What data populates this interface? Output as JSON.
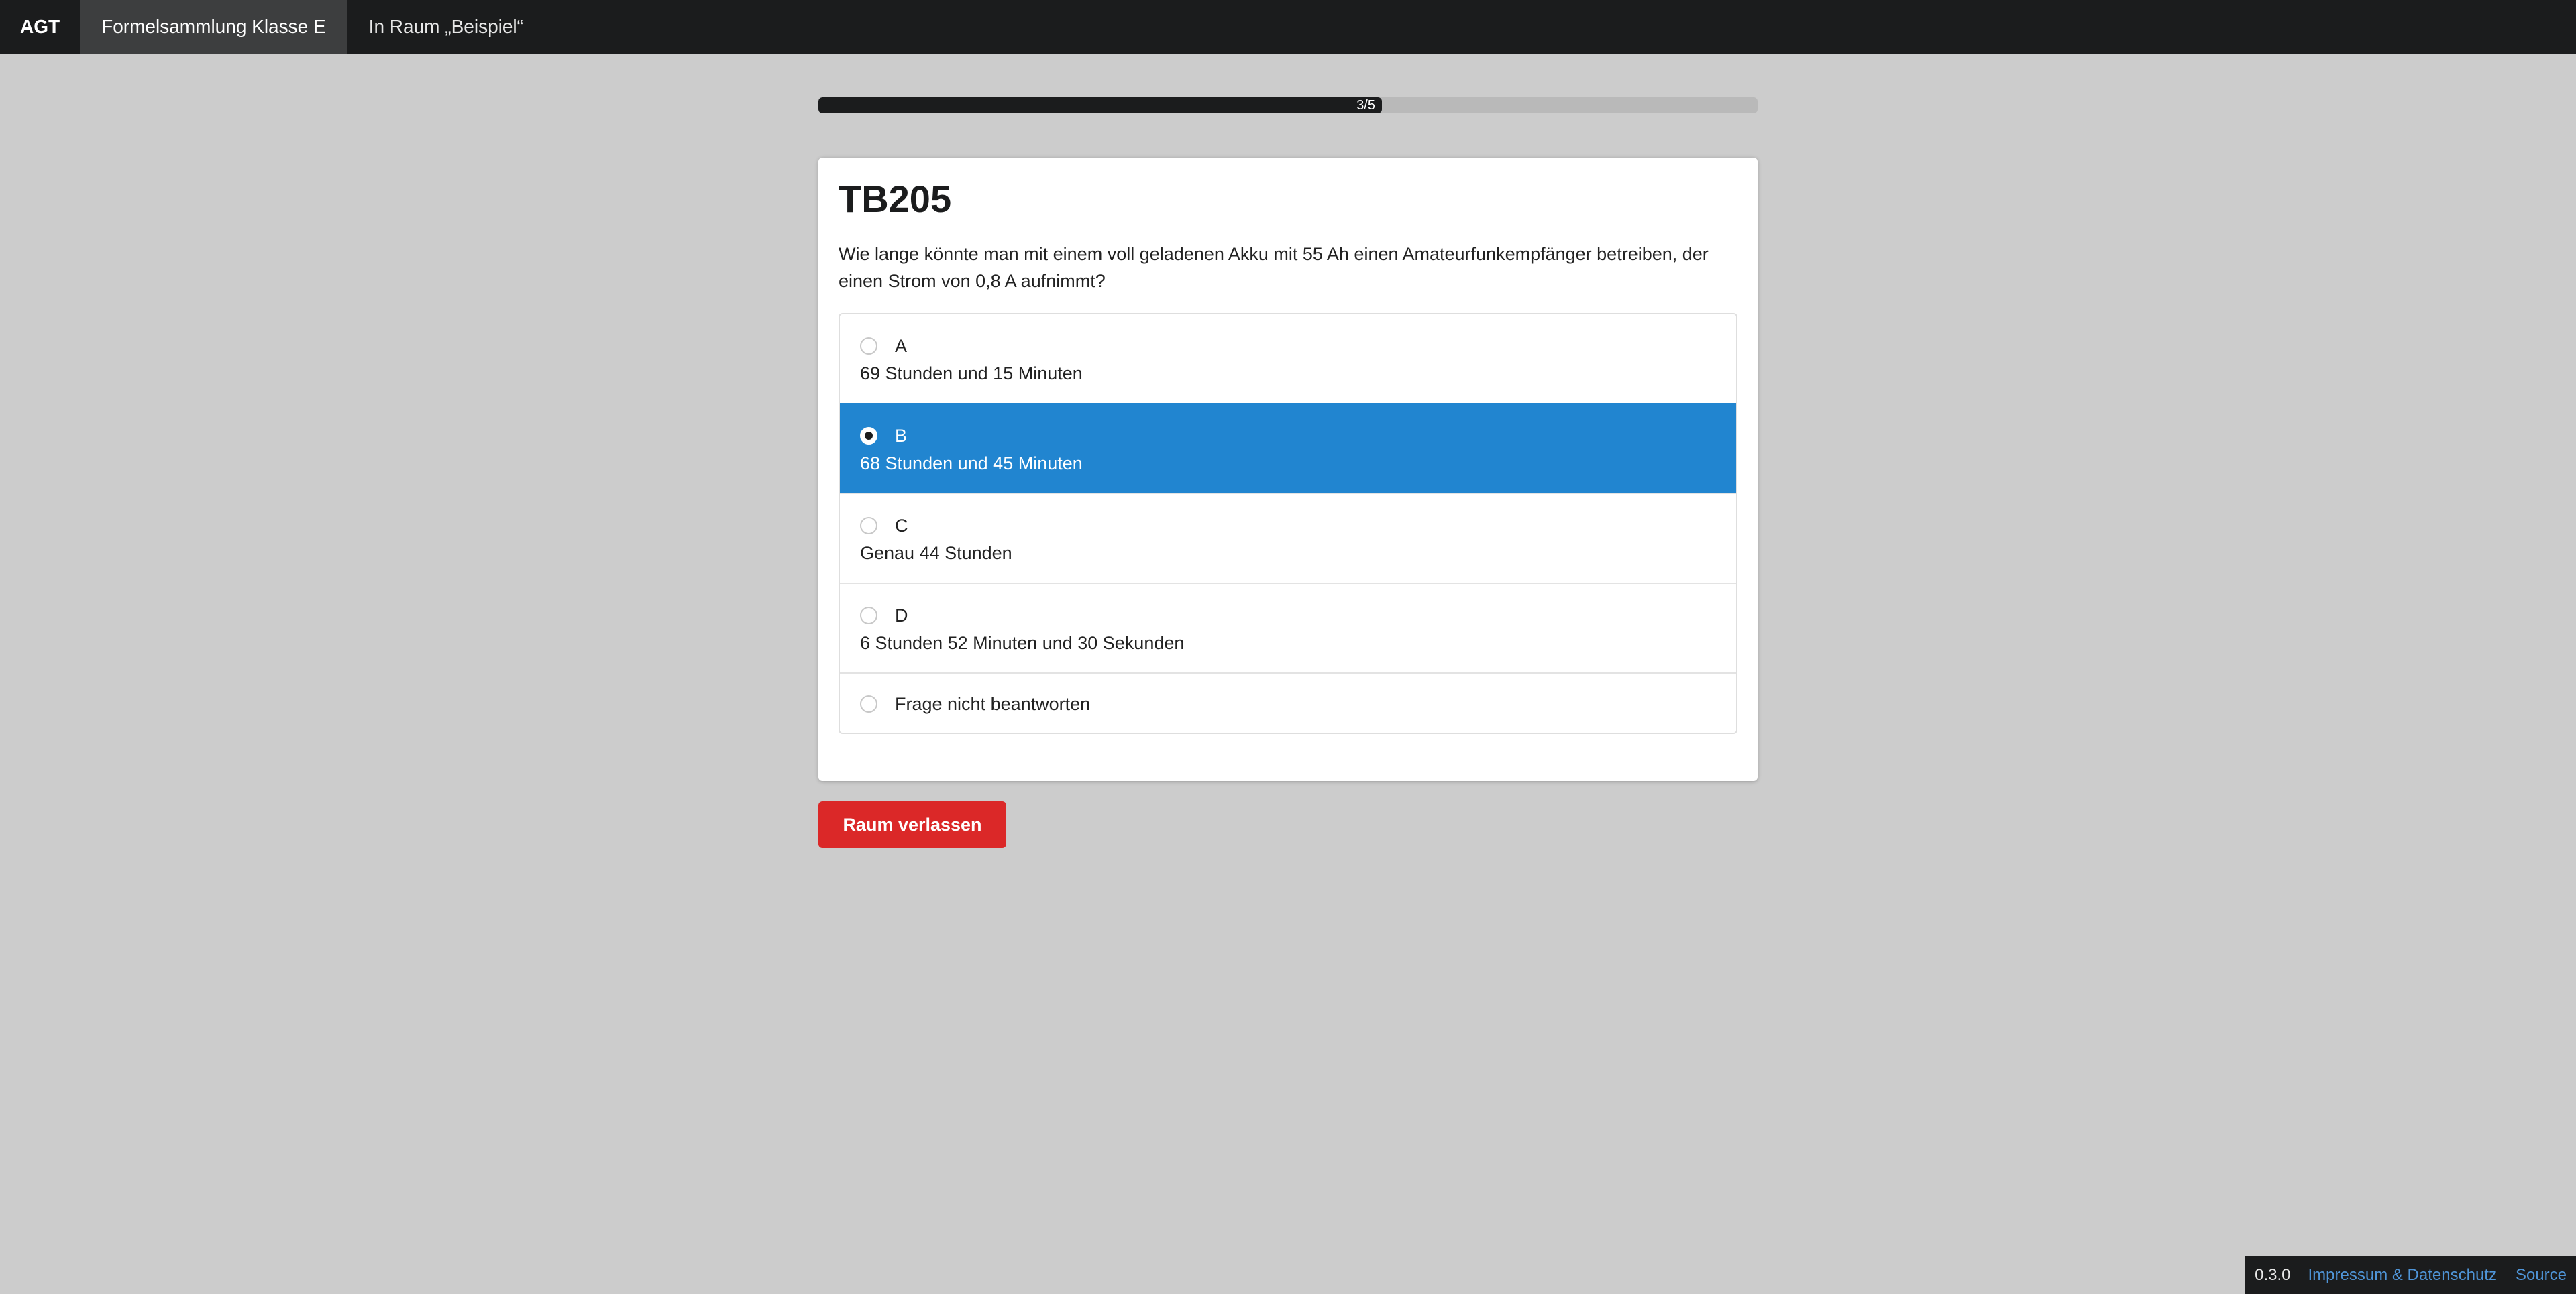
{
  "nav": {
    "brand": "AGT",
    "items": [
      {
        "label": "Formelsammlung Klasse E",
        "active": true
      },
      {
        "label": "In Raum „Beispiel“",
        "active": false
      }
    ]
  },
  "progress": {
    "label": "3/5",
    "current": 3,
    "total": 5,
    "fraction": 0.6
  },
  "question": {
    "id": "TB205",
    "text": "Wie lange könnte man mit einem voll geladenen Akku mit 55 Ah einen Amateurfunkempfänger betreiben, der einen Strom von 0,8 A aufnimmt?"
  },
  "answers": [
    {
      "letter": "A",
      "text": "69 Stunden und 15 Minuten",
      "selected": false
    },
    {
      "letter": "B",
      "text": "68 Stunden und 45 Minuten",
      "selected": true
    },
    {
      "letter": "C",
      "text": "Genau 44 Stunden",
      "selected": false
    },
    {
      "letter": "D",
      "text": "6 Stunden 52 Minuten und 30 Sekunden",
      "selected": false
    }
  ],
  "skip_label": "Frage nicht beantworten",
  "leave_button": "Raum verlassen",
  "footer": {
    "version": "0.3.0",
    "links": [
      "Impressum & Datenschutz",
      "Source"
    ]
  },
  "colors": {
    "selected": "#2185d0",
    "danger": "#db2828",
    "bar": "#1b1c1d",
    "link": "#4f95d8"
  }
}
